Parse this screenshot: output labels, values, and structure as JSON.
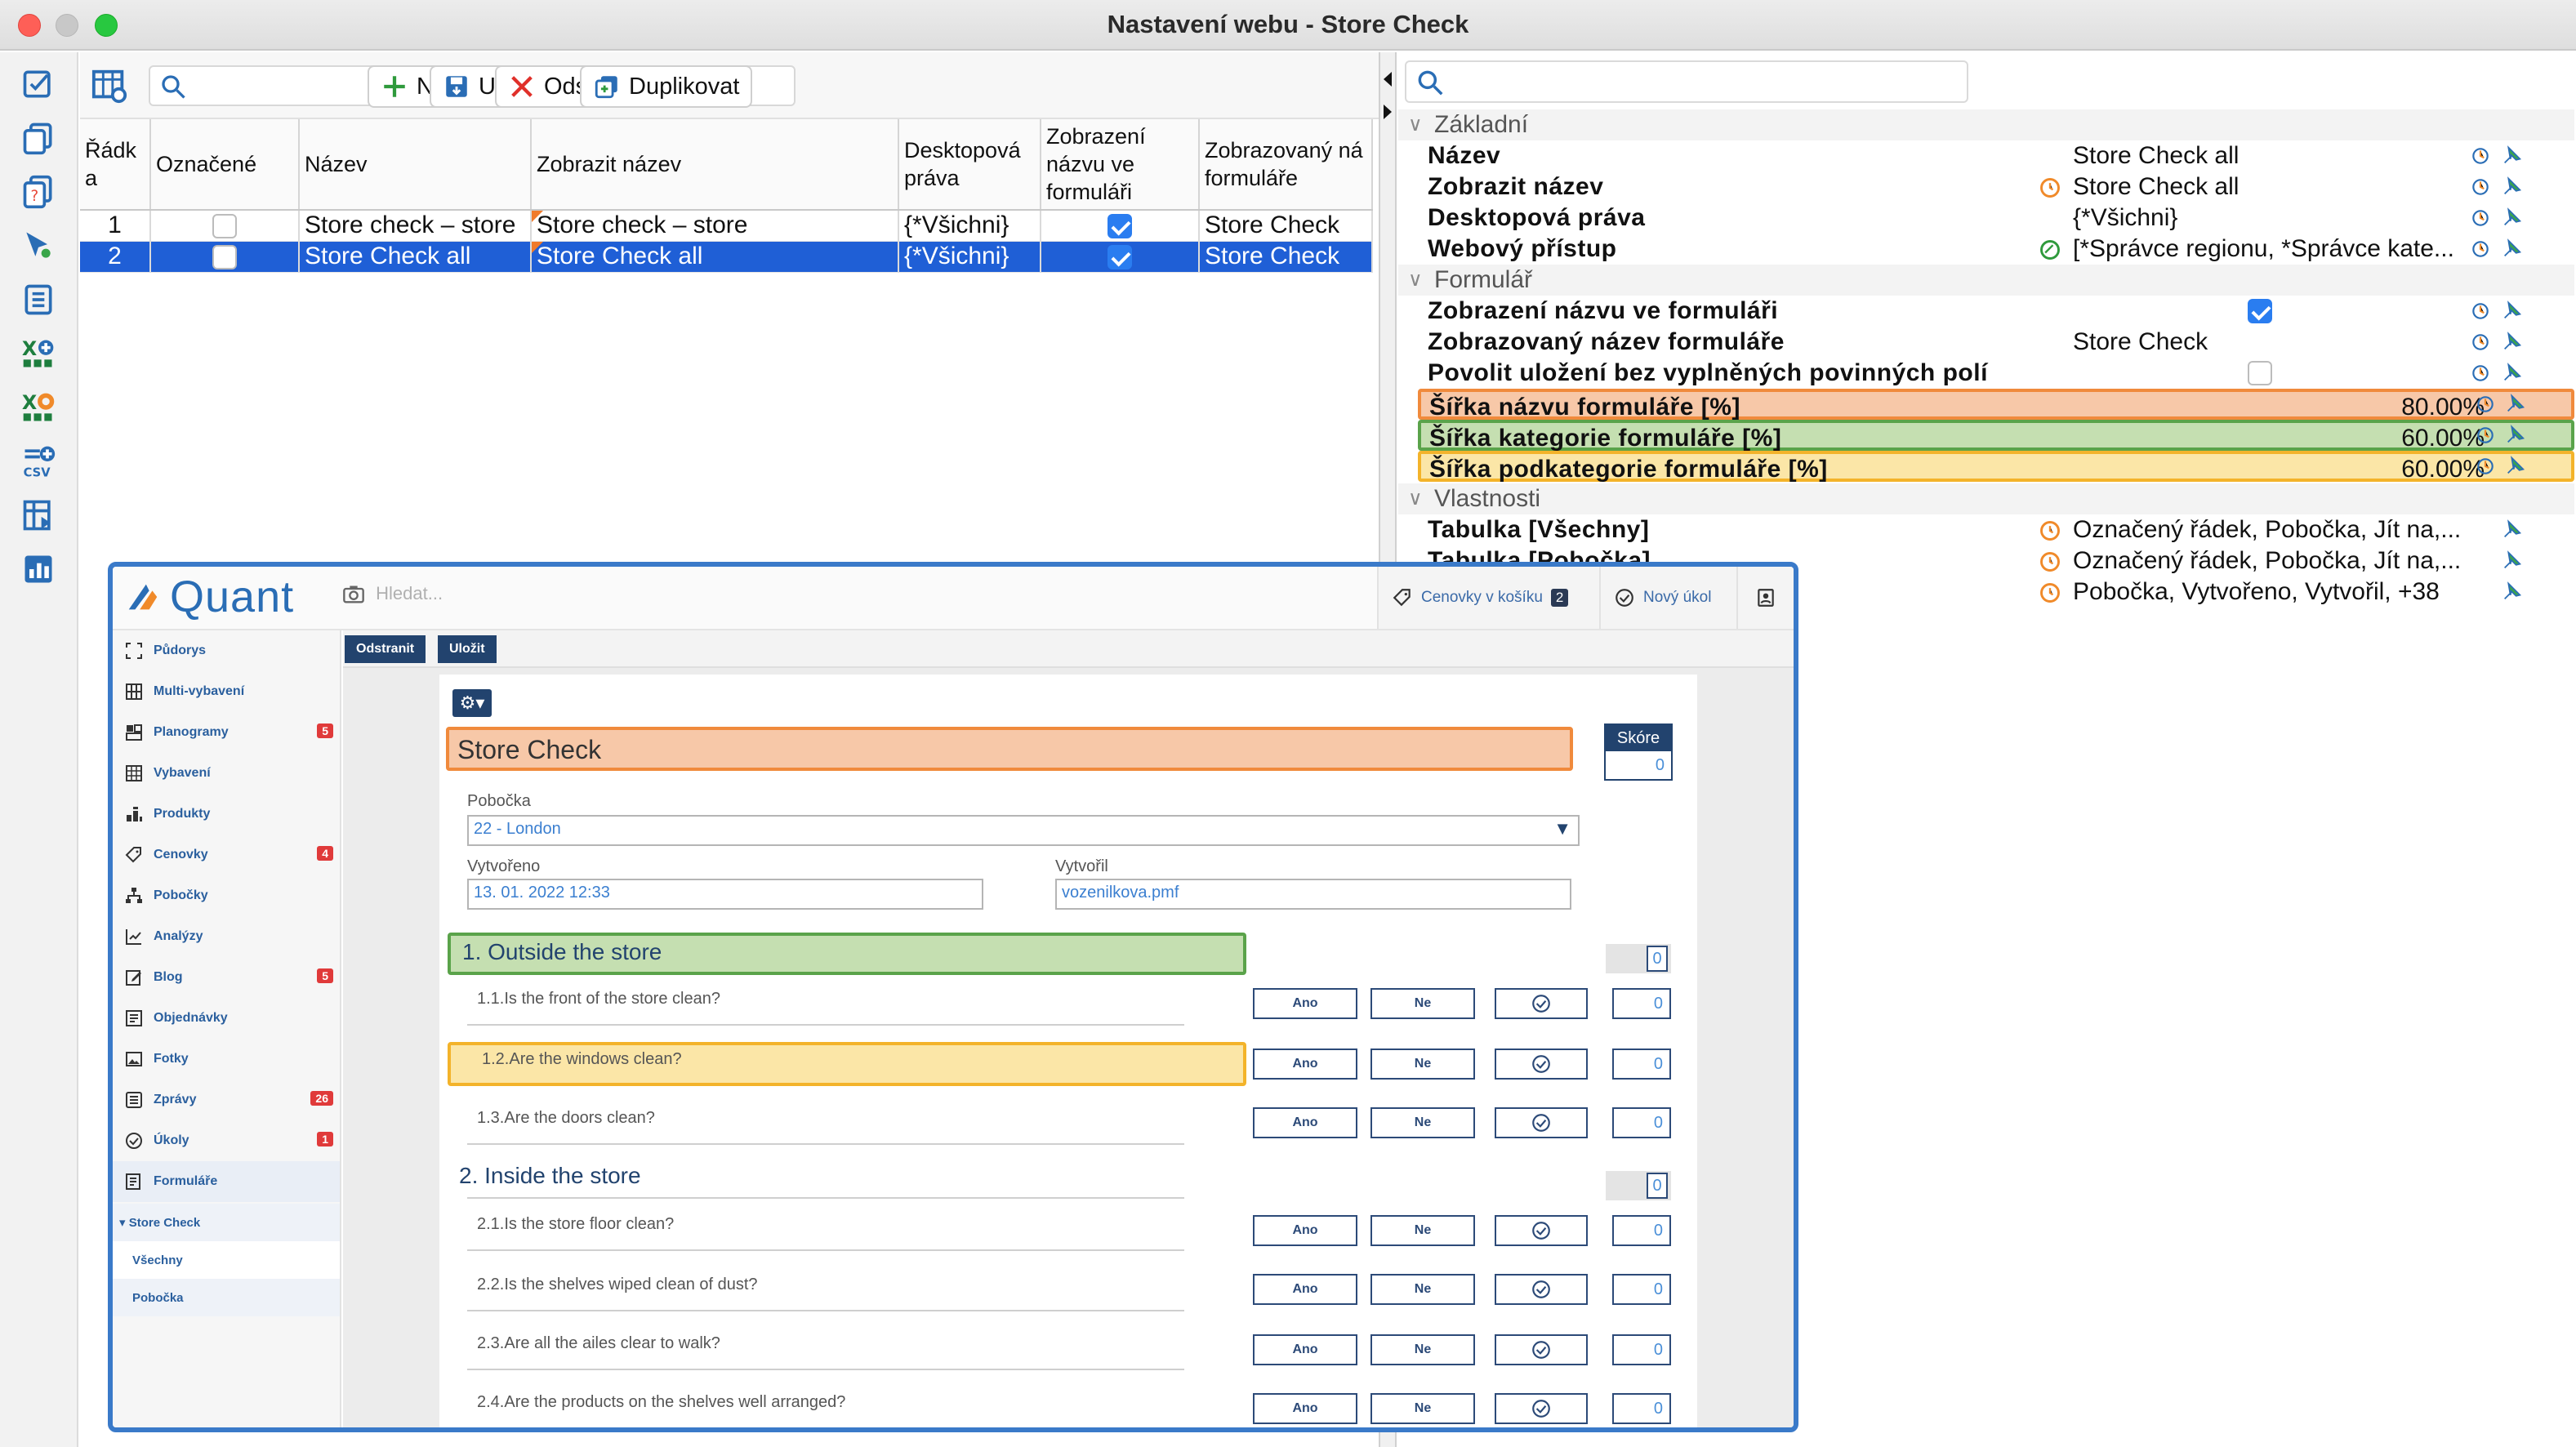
{
  "window": {
    "title": "Nastavení webu - Store Check"
  },
  "toolbar": {
    "search_placeholder": "",
    "new_label": "Nové",
    "save_label": "Uložit",
    "delete_label": "Odstranit",
    "duplicate_label": "Duplikovat"
  },
  "grid": {
    "headers": [
      "Řádk a",
      "Označené",
      "Název",
      "Zobrazit název",
      "Desktopová práva",
      "Zobrazení názvu ve formuláři",
      "Zobrazovaný ná formuláře"
    ],
    "rows": [
      {
        "num": "1",
        "marked": false,
        "name": "Store check – store",
        "display_name": "Store check – store",
        "rights": "{*Všichni}",
        "show_name": true,
        "form_name": "Store Check",
        "selected": false
      },
      {
        "num": "2",
        "marked": false,
        "name": "Store Check all",
        "display_name": "Store Check all",
        "rights": "{*Všichni}",
        "show_name": true,
        "form_name": "Store Check",
        "selected": true
      }
    ]
  },
  "properties": {
    "groups": {
      "basic": "Základní",
      "form": "Formulář",
      "props": "Vlastnosti"
    },
    "name_label": "Název",
    "name_value": "Store Check all",
    "display_name_label": "Zobrazit název",
    "display_name_value": "Store Check all",
    "desktop_rights_label": "Desktopová práva",
    "desktop_rights_value": "{*Všichni}",
    "web_access_label": "Webový přístup",
    "web_access_value": "[*Správce regionu, *Správce kate...",
    "show_name_label": "Zobrazení názvu ve formuláři",
    "form_display_label": "Zobrazovaný název formuláře",
    "form_display_value": "Store Check",
    "allow_save_label": "Povolit uložení bez vyplněných povinných polí",
    "title_width_label": "Šířka názvu formuláře [%]",
    "title_width_value": "80.00%",
    "cat_width_label": "Šířka kategorie formuláře [%]",
    "cat_width_value": "60.00%",
    "subcat_width_label": "Šířka podkategorie formuláře [%]",
    "subcat_width_value": "60.00%",
    "table_all_label": "Tabulka [Všechny]",
    "table_all_value": "Označený řádek, Pobočka, Jít na,...",
    "table_branch_label": "Tabulka [Pobočka]",
    "table_branch_value": "Označený řádek, Pobočka, Jít na,...",
    "row3_value": "Pobočka, Vytvořeno, Vytvořil, +38"
  },
  "webapp": {
    "logo": "Quant",
    "search_placeholder": "Hledat...",
    "cart_label": "Cenovky v košíku",
    "cart_count": "2",
    "new_task_label": "Nový úkol",
    "sidebar": [
      {
        "label": "Půdorys",
        "badge": ""
      },
      {
        "label": "Multi-vybavení",
        "badge": ""
      },
      {
        "label": "Planogramy",
        "badge": "5"
      },
      {
        "label": "Vybavení",
        "badge": ""
      },
      {
        "label": "Produkty",
        "badge": ""
      },
      {
        "label": "Cenovky",
        "badge": "4"
      },
      {
        "label": "Pobočky",
        "badge": ""
      },
      {
        "label": "Analýzy",
        "badge": ""
      },
      {
        "label": "Blog",
        "badge": "5"
      },
      {
        "label": "Objednávky",
        "badge": ""
      },
      {
        "label": "Fotky",
        "badge": ""
      },
      {
        "label": "Zprávy",
        "badge": "26"
      },
      {
        "label": "Úkoly",
        "badge": "1"
      },
      {
        "label": "Formuláře",
        "badge": ""
      }
    ],
    "sub_parent": "▾ Store Check",
    "sub_items": [
      "Všechny",
      "Pobočka"
    ],
    "actions": {
      "delete": "Odstranit",
      "save": "Uložit"
    },
    "form": {
      "title": "Store Check",
      "score_label": "Skóre",
      "score_value": "0",
      "branch_label": "Pobočka",
      "branch_value": "22 - London",
      "created_label": "Vytvořeno",
      "created_value": "13. 01. 2022 12:33",
      "creator_label": "Vytvořil",
      "creator_value": "vozenilkova.pmf",
      "yes": "Ano",
      "no": "Ne",
      "sections": [
        {
          "title": "1. Outside the store",
          "score": "0",
          "questions": [
            {
              "text": "1.1.Is the front of the store clean?",
              "value": "0"
            },
            {
              "text": "1.2.Are the windows clean?",
              "value": "0"
            },
            {
              "text": "1.3.Are the doors clean?",
              "value": "0"
            }
          ]
        },
        {
          "title": "2. Inside the store",
          "score": "0",
          "questions": [
            {
              "text": "2.1.Is the store floor clean?",
              "value": "0"
            },
            {
              "text": "2.2.Is the shelves wiped clean of dust?",
              "value": "0"
            },
            {
              "text": "2.3.Are all the ailes clear to walk?",
              "value": "0"
            },
            {
              "text": "2.4.Are the products on the shelves well arranged?",
              "value": "0"
            }
          ]
        }
      ]
    }
  },
  "colors": {
    "selection": "#1f5fd6",
    "highlight_orange": "#f7c8a8",
    "highlight_green": "#c5dfb1",
    "highlight_yellow": "#fbe6a7",
    "inset_border": "#3a7ac9",
    "brand_dark": "#22436e"
  }
}
